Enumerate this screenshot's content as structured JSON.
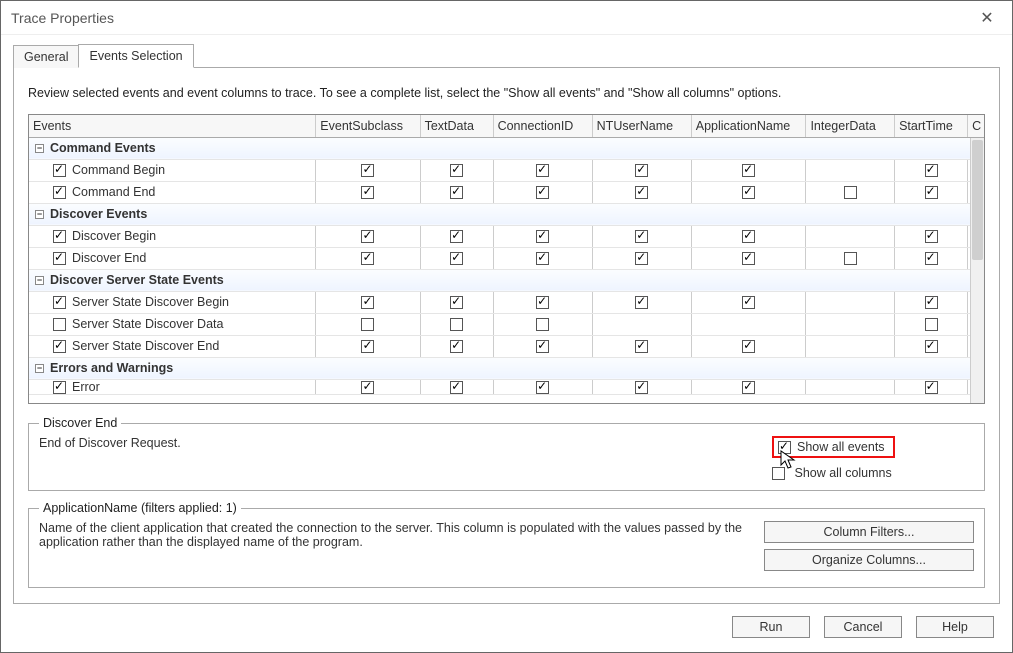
{
  "window": {
    "title": "Trace Properties"
  },
  "tabs": {
    "general": "General",
    "events": "Events Selection"
  },
  "instructions": "Review selected events and event columns to trace. To see a complete list, select the \"Show all events\" and \"Show all columns\" options.",
  "columns": {
    "events": "Events",
    "subclass": "EventSubclass",
    "textdata": "TextData",
    "conn": "ConnectionID",
    "ntuser": "NTUserName",
    "app": "ApplicationName",
    "intdata": "IntegerData",
    "start": "StartTime",
    "last": "C"
  },
  "groups": [
    {
      "label": "Command Events",
      "rows": [
        {
          "label": "Command Begin",
          "on": true,
          "cells": {
            "subclass": 1,
            "textdata": 1,
            "conn": 1,
            "ntuser": 1,
            "app": 1,
            "intdata": null,
            "start": 1
          }
        },
        {
          "label": "Command End",
          "on": true,
          "cells": {
            "subclass": 1,
            "textdata": 1,
            "conn": 1,
            "ntuser": 1,
            "app": 1,
            "intdata": 0,
            "start": 1
          }
        }
      ]
    },
    {
      "label": "Discover Events",
      "rows": [
        {
          "label": "Discover Begin",
          "on": true,
          "cells": {
            "subclass": 1,
            "textdata": 1,
            "conn": 1,
            "ntuser": 1,
            "app": 1,
            "intdata": null,
            "start": 1
          }
        },
        {
          "label": "Discover End",
          "on": true,
          "cells": {
            "subclass": 1,
            "textdata": 1,
            "conn": 1,
            "ntuser": 1,
            "app": 1,
            "intdata": 0,
            "start": 1
          }
        }
      ]
    },
    {
      "label": "Discover Server State Events",
      "rows": [
        {
          "label": "Server State Discover Begin",
          "on": true,
          "cells": {
            "subclass": 1,
            "textdata": 1,
            "conn": 1,
            "ntuser": 1,
            "app": 1,
            "intdata": null,
            "start": 1
          }
        },
        {
          "label": "Server State Discover Data",
          "on": false,
          "cells": {
            "subclass": 0,
            "textdata": 0,
            "conn": 0,
            "ntuser": null,
            "app": null,
            "intdata": null,
            "start": 0
          }
        },
        {
          "label": "Server State Discover End",
          "on": true,
          "cells": {
            "subclass": 1,
            "textdata": 1,
            "conn": 1,
            "ntuser": 1,
            "app": 1,
            "intdata": null,
            "start": 1
          }
        }
      ]
    },
    {
      "label": "Errors and Warnings",
      "rows": [
        {
          "label": "Error",
          "on": true,
          "cells": {
            "subclass": 1,
            "textdata": 1,
            "conn": 1,
            "ntuser": 1,
            "app": 1,
            "intdata": null,
            "start": 1
          },
          "partial": true
        }
      ]
    }
  ],
  "event_desc": {
    "title": "Discover End",
    "text": "End of Discover Request."
  },
  "options": {
    "show_all_events": {
      "label": "Show all events",
      "checked": true
    },
    "show_all_columns": {
      "label": "Show all columns",
      "checked": false
    }
  },
  "column_desc": {
    "title": "ApplicationName (filters applied: 1)",
    "text": "Name of the client application that created the connection to the server. This column is populated with the values passed by the application rather than the displayed name of the program."
  },
  "buttons": {
    "column_filters": "Column Filters...",
    "organize_columns": "Organize Columns...",
    "run": "Run",
    "cancel": "Cancel",
    "help": "Help"
  }
}
